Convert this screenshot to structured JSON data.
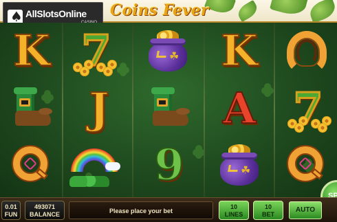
{
  "header": {
    "title": "Coins Fever",
    "watermark": {
      "brand": "AllSlotsOnline",
      "sub": ".CASINO"
    }
  },
  "reels": {
    "columns": [
      [
        "K",
        "boot",
        "Q"
      ],
      [
        "7",
        "J",
        "rainbow"
      ],
      [
        "pot",
        "boot",
        "9"
      ],
      [
        "K",
        "A",
        "pot"
      ],
      [
        "horseshoe",
        "7",
        "Q"
      ]
    ]
  },
  "bottom_bar": {
    "fun_value": "0.01",
    "fun_label": "FUN",
    "balance_value": "493071",
    "balance_label": "BALANCE",
    "message": "Please place your bet",
    "lines_value": "10",
    "lines_label": "LINES",
    "bet_value": "10",
    "bet_label": "BET",
    "auto_label": "AUTO",
    "spin_label": "SPIN"
  },
  "colors": {
    "header_bg": "#fbf6e6",
    "title_gold": "#e7a416",
    "reels_bg": "#2f6a2c",
    "bar_bg": "#3c2c1a",
    "button_green": "#5ab83a"
  }
}
